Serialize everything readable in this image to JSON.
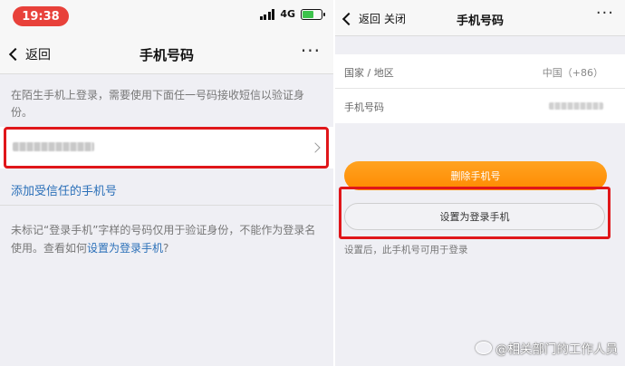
{
  "left": {
    "status": {
      "time": "19:38",
      "network": "4G"
    },
    "nav": {
      "back_label": "返回",
      "title": "手机号码",
      "more": "···"
    },
    "description": "在陌生手机上登录，需要使用下面任一号码接收短信以验证身份。",
    "add_trusted": "添加受信任的手机号",
    "note_prefix": "未标记“登录手机”字样的号码仅用于验证身份，不能作为登录名使用。查看如何",
    "note_link": "设置为登录手机",
    "note_suffix": "?"
  },
  "right": {
    "nav": {
      "back_label": "返回",
      "close_label": "关闭",
      "title": "手机号码",
      "more": "···"
    },
    "rows": [
      {
        "label": "国家 / 地区",
        "value": "中国（+86）"
      },
      {
        "label": "手机号码"
      }
    ],
    "delete_button": "删除手机号",
    "set_login_button": "设置为登录手机",
    "tip": "设置后，此手机号可用于登录"
  },
  "watermark": "@相关部门的工作人员",
  "colors": {
    "accent_orange": "#ff8a00",
    "highlight_red": "#e0161a",
    "link_blue": "#2a6fb8",
    "time_pill": "#e8413a"
  }
}
